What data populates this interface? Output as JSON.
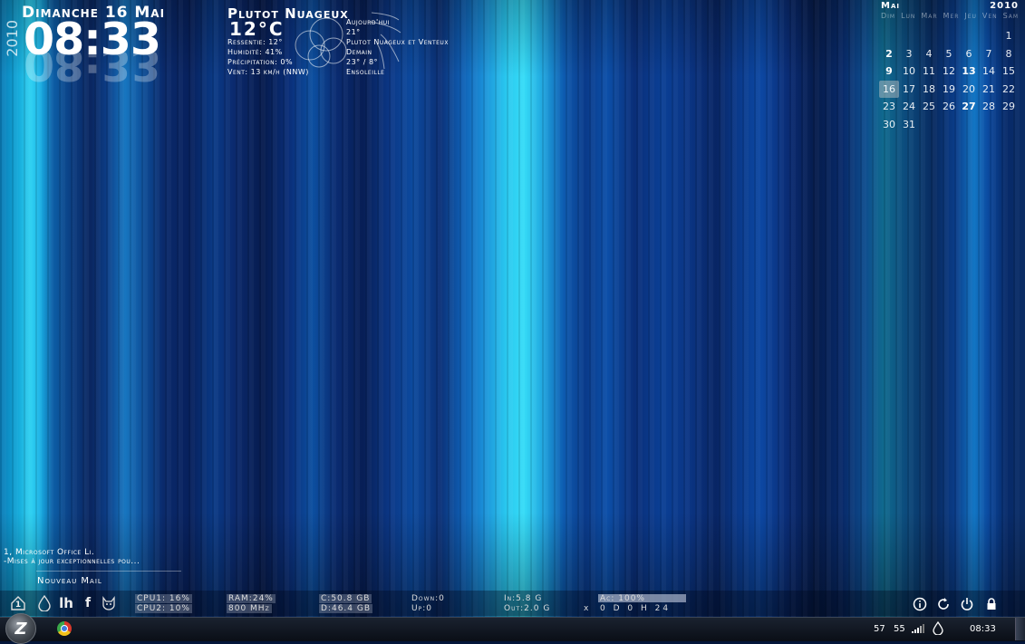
{
  "clock": {
    "date": "Dimanche 16 Mai",
    "year": "2010",
    "time": "08:33"
  },
  "weather": {
    "condition": "Plutot Nuageux",
    "temperature": "12°C",
    "feels_like": "Ressentie: 12°",
    "humidity": "Humidité: 41%",
    "precipitation": "Précipitation: 0%",
    "wind": "Vent: 13 km/h (NNW)",
    "today_label": "Aujourd'hui",
    "today_temp": "21°",
    "today_desc": "Plutot Nuageux et Venteux",
    "tomorrow_label": "Demain",
    "tomorrow_temp": "23° / 8°",
    "tomorrow_desc": "Ensoleille"
  },
  "calendar": {
    "month": "Mai",
    "year": "2010",
    "weekdays": [
      "Dim",
      "Lun",
      "Mar",
      "Mer",
      "Jeu",
      "Ven",
      "Sam"
    ],
    "days": [
      "",
      "",
      "",
      "",
      "",
      "",
      "1",
      "2",
      "3",
      "4",
      "5",
      "6",
      "7",
      "8",
      "9",
      "10",
      "11",
      "12",
      "13",
      "14",
      "15",
      "16",
      "17",
      "18",
      "19",
      "20",
      "21",
      "22",
      "23",
      "24",
      "25",
      "26",
      "27",
      "28",
      "29",
      "30",
      "31"
    ],
    "bold_days": [
      "2",
      "9",
      "13",
      "27"
    ],
    "today": "16"
  },
  "news": {
    "line1": "1, Microsoft Office Li.",
    "line2": "-Mises à jour exceptionnelles pou...",
    "mail": "Nouveau Mail"
  },
  "dock": {
    "home_badge": "1",
    "drop_glyph": "💧",
    "lh_glyph": "lh",
    "fb_glyph": "f",
    "cat_glyph": "☺",
    "cpu1": "CPU1: 16%",
    "cpu2": "CPU2: 10%",
    "ram": "RAM:24%",
    "freq": "800 MHz",
    "disk_c": "C:50.8 GB",
    "disk_d": "D:46.4 GB",
    "down": "Down:0",
    "up": "Up:0",
    "in": "In:5.8 G",
    "out": "Out:2.0 G",
    "ac": "Ac:  100%",
    "ac_level": 1.0,
    "uptime_x": "x",
    "uptime": "0 D 0 H 24"
  },
  "taskbar": {
    "start_glyph": "Z",
    "tray_num1": "57",
    "tray_num2": "55",
    "clock": "08:33"
  }
}
